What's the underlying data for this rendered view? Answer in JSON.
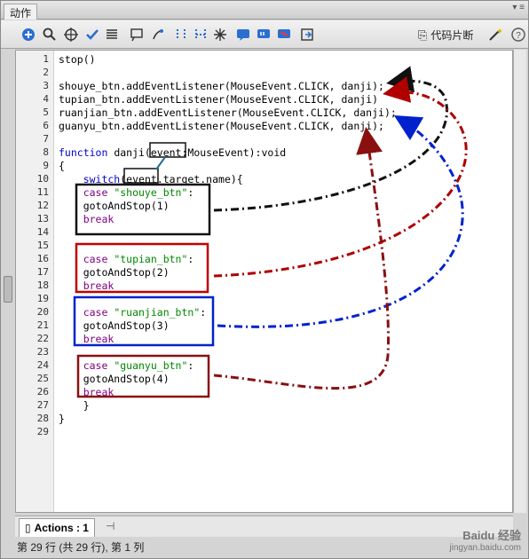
{
  "window": {
    "title": "动作"
  },
  "toolbar": {
    "buttons": [
      "add",
      "find",
      "target",
      "check",
      "format",
      "debug",
      "collapse",
      "expand",
      "comment",
      "uncomment",
      "help",
      "pin"
    ],
    "snippets_label": "代码片断"
  },
  "editor": {
    "lines": [
      {
        "n": "1",
        "segments": [
          {
            "t": "stop()",
            "c": ""
          }
        ]
      },
      {
        "n": "2",
        "segments": []
      },
      {
        "n": "3",
        "segments": [
          {
            "t": "shouye_btn.addEventListener(MouseEvent.CLICK, danji);",
            "c": ""
          }
        ]
      },
      {
        "n": "4",
        "segments": [
          {
            "t": "tupian_btn.addEventListener(MouseEvent.CLICK, danji)",
            "c": ""
          }
        ]
      },
      {
        "n": "5",
        "segments": [
          {
            "t": "ruanjian_btn.addEventListener(MouseEvent.CLICK, danji);",
            "c": ""
          }
        ]
      },
      {
        "n": "6",
        "segments": [
          {
            "t": "guanyu_btn.addEventListener(MouseEvent.CLICK, danji);",
            "c": ""
          }
        ]
      },
      {
        "n": "7",
        "segments": []
      },
      {
        "n": "8",
        "segments": [
          {
            "t": "function",
            "c": "kw"
          },
          {
            "t": " danji(event:MouseEvent):void",
            "c": ""
          }
        ]
      },
      {
        "n": "9",
        "segments": [
          {
            "t": "{",
            "c": ""
          }
        ]
      },
      {
        "n": "10",
        "segments": [
          {
            "t": "    switch",
            "c": "kw"
          },
          {
            "t": "(event.target.name){",
            "c": ""
          }
        ]
      },
      {
        "n": "11",
        "segments": [
          {
            "t": "    case ",
            "c": "pur"
          },
          {
            "t": "\"shouye_btn\"",
            "c": "str"
          },
          {
            "t": ":",
            "c": ""
          }
        ]
      },
      {
        "n": "12",
        "segments": [
          {
            "t": "    gotoAndStop(1)",
            "c": ""
          }
        ]
      },
      {
        "n": "13",
        "segments": [
          {
            "t": "    break",
            "c": "pur"
          }
        ]
      },
      {
        "n": "14",
        "segments": []
      },
      {
        "n": "15",
        "segments": []
      },
      {
        "n": "16",
        "segments": [
          {
            "t": "    case ",
            "c": "pur"
          },
          {
            "t": "\"tupian_btn\"",
            "c": "str"
          },
          {
            "t": ":",
            "c": ""
          }
        ]
      },
      {
        "n": "17",
        "segments": [
          {
            "t": "    gotoAndStop(2)",
            "c": ""
          }
        ]
      },
      {
        "n": "18",
        "segments": [
          {
            "t": "    break",
            "c": "pur"
          }
        ]
      },
      {
        "n": "19",
        "segments": []
      },
      {
        "n": "20",
        "segments": [
          {
            "t": "    case ",
            "c": "pur"
          },
          {
            "t": "\"ruanjian_btn\"",
            "c": "str"
          },
          {
            "t": ":",
            "c": ""
          }
        ]
      },
      {
        "n": "21",
        "segments": [
          {
            "t": "    gotoAndStop(3)",
            "c": ""
          }
        ]
      },
      {
        "n": "22",
        "segments": [
          {
            "t": "    break",
            "c": "pur"
          }
        ]
      },
      {
        "n": "23",
        "segments": []
      },
      {
        "n": "24",
        "segments": [
          {
            "t": "    case ",
            "c": "pur"
          },
          {
            "t": "\"guanyu_btn\"",
            "c": "str"
          },
          {
            "t": ":",
            "c": ""
          }
        ]
      },
      {
        "n": "25",
        "segments": [
          {
            "t": "    gotoAndStop(4)",
            "c": ""
          }
        ]
      },
      {
        "n": "26",
        "segments": [
          {
            "t": "    break",
            "c": "pur"
          }
        ]
      },
      {
        "n": "27",
        "segments": [
          {
            "t": "    }",
            "c": ""
          }
        ]
      },
      {
        "n": "28",
        "segments": [
          {
            "t": "}",
            "c": ""
          }
        ]
      },
      {
        "n": "29",
        "segments": []
      }
    ]
  },
  "tabs": {
    "active": "Actions : 1"
  },
  "status": {
    "text": "第 29 行 (共 29 行), 第 1 列"
  },
  "watermark": {
    "brand": "Baidu 经验",
    "url": "jingyan.baidu.com"
  },
  "colors": {
    "black": "#111111",
    "red": "#b00000",
    "blue": "#0022cc",
    "darkred": "#8a1010"
  }
}
